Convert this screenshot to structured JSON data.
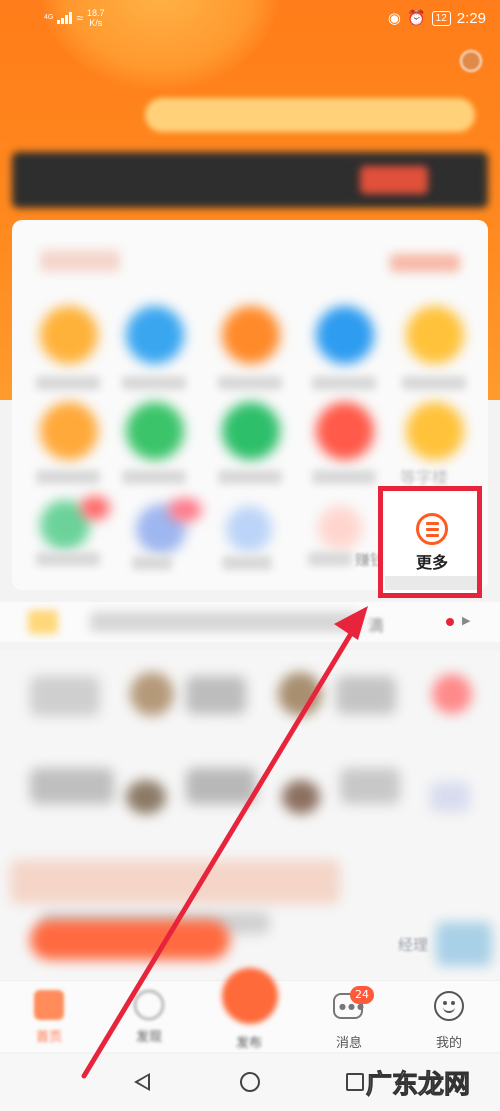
{
  "status_bar": {
    "network": "4G",
    "speed": "18.7\nK/s",
    "battery": "12",
    "time": "2:29"
  },
  "more_button": {
    "label": "更多"
  },
  "obscured_labels": {
    "grid_item": "等字楼",
    "earn": "赚钱",
    "ticker_word": "滴"
  },
  "tabs": [
    {
      "label": "首页"
    },
    {
      "label": "发现"
    },
    {
      "label": "发布"
    },
    {
      "label": "消息"
    },
    {
      "label": "我的"
    }
  ],
  "messages_badge": "24",
  "manager_label": "经理",
  "watermark": "广东龙网",
  "colors": {
    "brand_orange": "#ff7d1a",
    "highlight_red": "#e8243c"
  }
}
